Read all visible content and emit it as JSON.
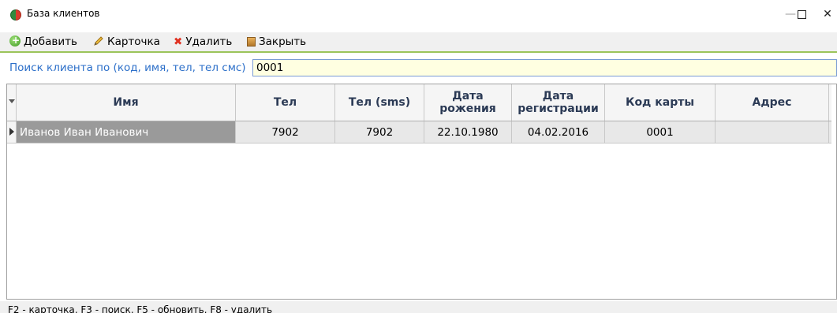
{
  "window": {
    "title": "База клиентов",
    "min_glyph": "—",
    "close_glyph": "✕"
  },
  "toolbar": {
    "add_label": "Добавить",
    "card_label": "Карточка",
    "delete_label": "Удалить",
    "close_label": "Закрыть",
    "delete_glyph": "✖"
  },
  "search": {
    "label": "Поиск клиента по (код, имя, тел, тел смс)",
    "value": "0001"
  },
  "grid": {
    "columns": [
      "Имя",
      "Тел",
      "Тел (sms)",
      "Дата рожения",
      "Дата регистрации",
      "Код карты",
      "Адрес"
    ],
    "rows": [
      [
        "Иванов Иван Иванович",
        "7902",
        "7902",
        "22.10.1980",
        "04.02.2016",
        "0001",
        ""
      ]
    ]
  },
  "status": {
    "text": "F2 - карточка, F3 - поиск, F5 - обновить, F8 - удалить"
  },
  "colors": {
    "accent_green": "#9bc45a",
    "search_label": "#2c6fc9",
    "header_text": "#2b3a55"
  }
}
